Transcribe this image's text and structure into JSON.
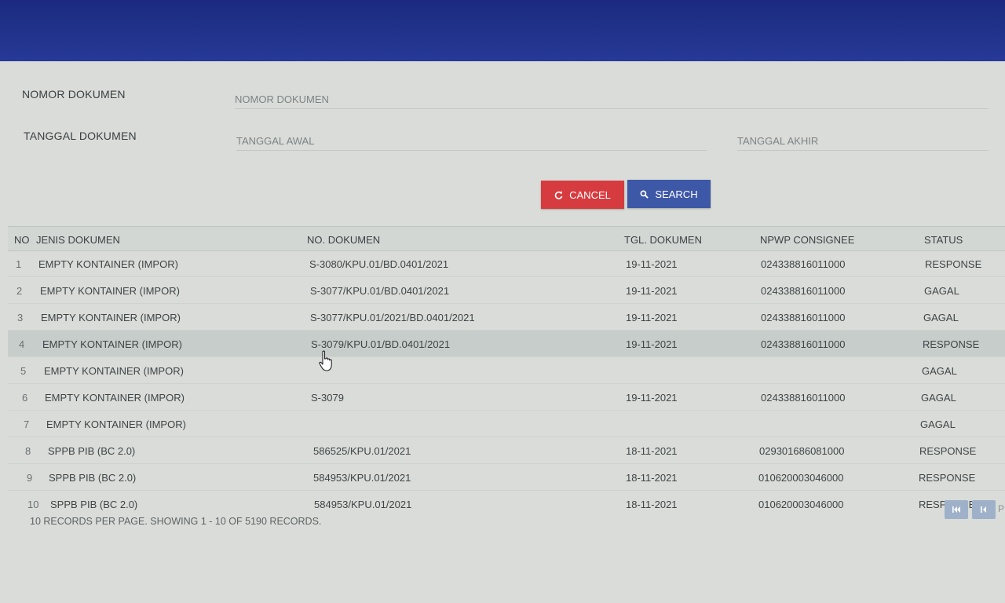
{
  "form": {
    "nomor_label": "NOMOR DOKUMEN",
    "nomor_placeholder": "NOMOR DOKUMEN",
    "tanggal_label": "TANGGAL DOKUMEN",
    "tanggal_awal_placeholder": "TANGGAL AWAL",
    "tanggal_akhir_placeholder": "TANGGAL AKHIR"
  },
  "buttons": {
    "cancel": "CANCEL",
    "search": "SEARCH"
  },
  "table": {
    "headers": [
      "NO",
      "JENIS DOKUMEN",
      "NO. DOKUMEN",
      "TGL. DOKUMEN",
      "NPWP CONSIGNEE",
      "STATUS"
    ],
    "rows": [
      {
        "no": "1",
        "jenis": "EMPTY KONTAINER (IMPOR)",
        "dokumen": "S-3080/KPU.01/BD.0401/2021",
        "tgl": "19-11-2021",
        "npwp": "024338816011000",
        "status": "RESPONSE"
      },
      {
        "no": "2",
        "jenis": "EMPTY KONTAINER (IMPOR)",
        "dokumen": "S-3077/KPU.01/BD.0401/2021",
        "tgl": "19-11-2021",
        "npwp": "024338816011000",
        "status": "GAGAL"
      },
      {
        "no": "3",
        "jenis": "EMPTY KONTAINER (IMPOR)",
        "dokumen": "S-3077/KPU.01/2021/BD.0401/2021",
        "tgl": "19-11-2021",
        "npwp": "024338816011000",
        "status": "GAGAL"
      },
      {
        "no": "4",
        "jenis": "EMPTY KONTAINER (IMPOR)",
        "dokumen": "S-3079/KPU.01/BD.0401/2021",
        "tgl": "19-11-2021",
        "npwp": "024338816011000",
        "status": "RESPONSE"
      },
      {
        "no": "5",
        "jenis": "EMPTY KONTAINER (IMPOR)",
        "dokumen": "",
        "tgl": "",
        "npwp": "",
        "status": "GAGAL"
      },
      {
        "no": "6",
        "jenis": "EMPTY KONTAINER (IMPOR)",
        "dokumen": "S-3079",
        "tgl": "19-11-2021",
        "npwp": "024338816011000",
        "status": "GAGAL"
      },
      {
        "no": "7",
        "jenis": "EMPTY KONTAINER (IMPOR)",
        "dokumen": "",
        "tgl": "",
        "npwp": "",
        "status": "GAGAL"
      },
      {
        "no": "8",
        "jenis": "SPPB PIB (BC 2.0)",
        "dokumen": "586525/KPU.01/2021",
        "tgl": "18-11-2021",
        "npwp": "029301686081000",
        "status": "RESPONSE"
      },
      {
        "no": "9",
        "jenis": "SPPB PIB (BC 2.0)",
        "dokumen": "584953/KPU.01/2021",
        "tgl": "18-11-2021",
        "npwp": "010620003046000",
        "status": "RESPONSE"
      },
      {
        "no": "10",
        "jenis": "SPPB PIB (BC 2.0)",
        "dokumen": "584953/KPU.01/2021",
        "tgl": "18-11-2021",
        "npwp": "010620003046000",
        "status": "RESPONSE"
      }
    ]
  },
  "footer": {
    "records_text": "10 RECORDS PER PAGE. SHOWING 1 - 10 OF 5190 RECORDS."
  },
  "pager": {
    "more": "P"
  },
  "colors": {
    "topbar": "#23358e",
    "cancel": "#d63b3f",
    "search": "#3e58a8"
  },
  "icons": {
    "cancel": "refresh-icon",
    "search": "search-icon",
    "pager_first": "first-page-icon",
    "pager_prev": "prev-page-icon"
  }
}
